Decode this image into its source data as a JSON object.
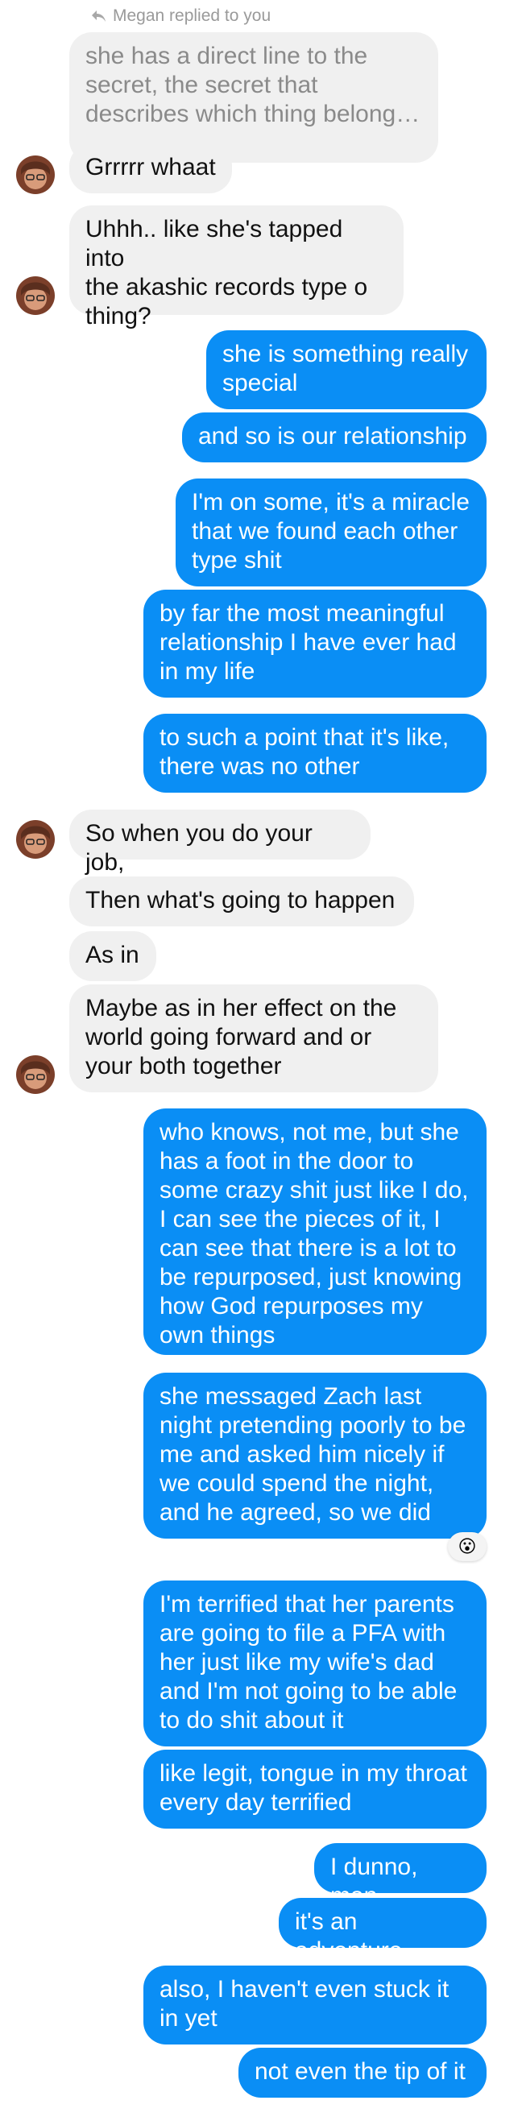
{
  "reply_note": {
    "icon": "reply-arrow-icon",
    "text": "Megan replied to you"
  },
  "messages": [
    {
      "id": "m0",
      "from": "them",
      "quoted": true,
      "text": "she has a direct line to the\nsecret, the secret that\ndescribes which thing belong…"
    },
    {
      "id": "m1",
      "from": "them",
      "text": "Grrrrr whaat"
    },
    {
      "id": "m2",
      "from": "them",
      "text": "Uhhh.. like she's tapped into\nthe akashic records type o\nthing?"
    },
    {
      "id": "m3",
      "from": "me",
      "text": "she is something really\nspecial"
    },
    {
      "id": "m4",
      "from": "me",
      "text": "and so is our relationship"
    },
    {
      "id": "m5",
      "from": "me",
      "text": "I'm on some, it's a miracle\nthat we found each other\ntype shit"
    },
    {
      "id": "m6",
      "from": "me",
      "text": "by far the most meaningful\nrelationship I have ever had\nin my life"
    },
    {
      "id": "m7",
      "from": "me",
      "text": "to such a point that it's like,\nthere was no other"
    },
    {
      "id": "m8",
      "from": "them",
      "text": "So when you do your job,"
    },
    {
      "id": "m9",
      "from": "them",
      "text": "Then what's going to happen"
    },
    {
      "id": "m10",
      "from": "them",
      "text": "As in"
    },
    {
      "id": "m11",
      "from": "them",
      "text": "Maybe as in her effect on the\nworld going forward and or\nyour both together"
    },
    {
      "id": "m12",
      "from": "me",
      "text": "who knows, not me, but she\nhas a foot in the door to\nsome crazy shit just like I do,\nI can see the pieces of it, I\ncan see that there is a lot to\nbe repurposed, just knowing\nhow God repurposes my\nown things"
    },
    {
      "id": "m13",
      "from": "me",
      "text": "she messaged Zach last\nnight pretending poorly to be\nme and asked him nicely if\nwe could spend the night,\nand he agreed, so we did"
    },
    {
      "id": "m14",
      "from": "me",
      "text": "I'm terrified that her parents\nare going to file a PFA with\nher just like my wife's dad\nand I'm not going to be able\nto do shit about it"
    },
    {
      "id": "m15",
      "from": "me",
      "text": "like legit, tongue in my throat\nevery day terrified"
    },
    {
      "id": "m16",
      "from": "me",
      "text": "I dunno, man"
    },
    {
      "id": "m17",
      "from": "me",
      "text": "it's an adventure"
    },
    {
      "id": "m18",
      "from": "me",
      "text": "also, I haven't even stuck it\nin yet"
    },
    {
      "id": "m19",
      "from": "me",
      "text": "not even the tip of it"
    }
  ],
  "reaction": {
    "emoji": "😮",
    "icon": "surprised-face-icon"
  },
  "colors": {
    "outgoing_bubble": "#0a8ef5",
    "incoming_bubble": "#f0f0f0",
    "quoted_text": "#8a8a8a",
    "meta_text": "#9a9a9a"
  }
}
